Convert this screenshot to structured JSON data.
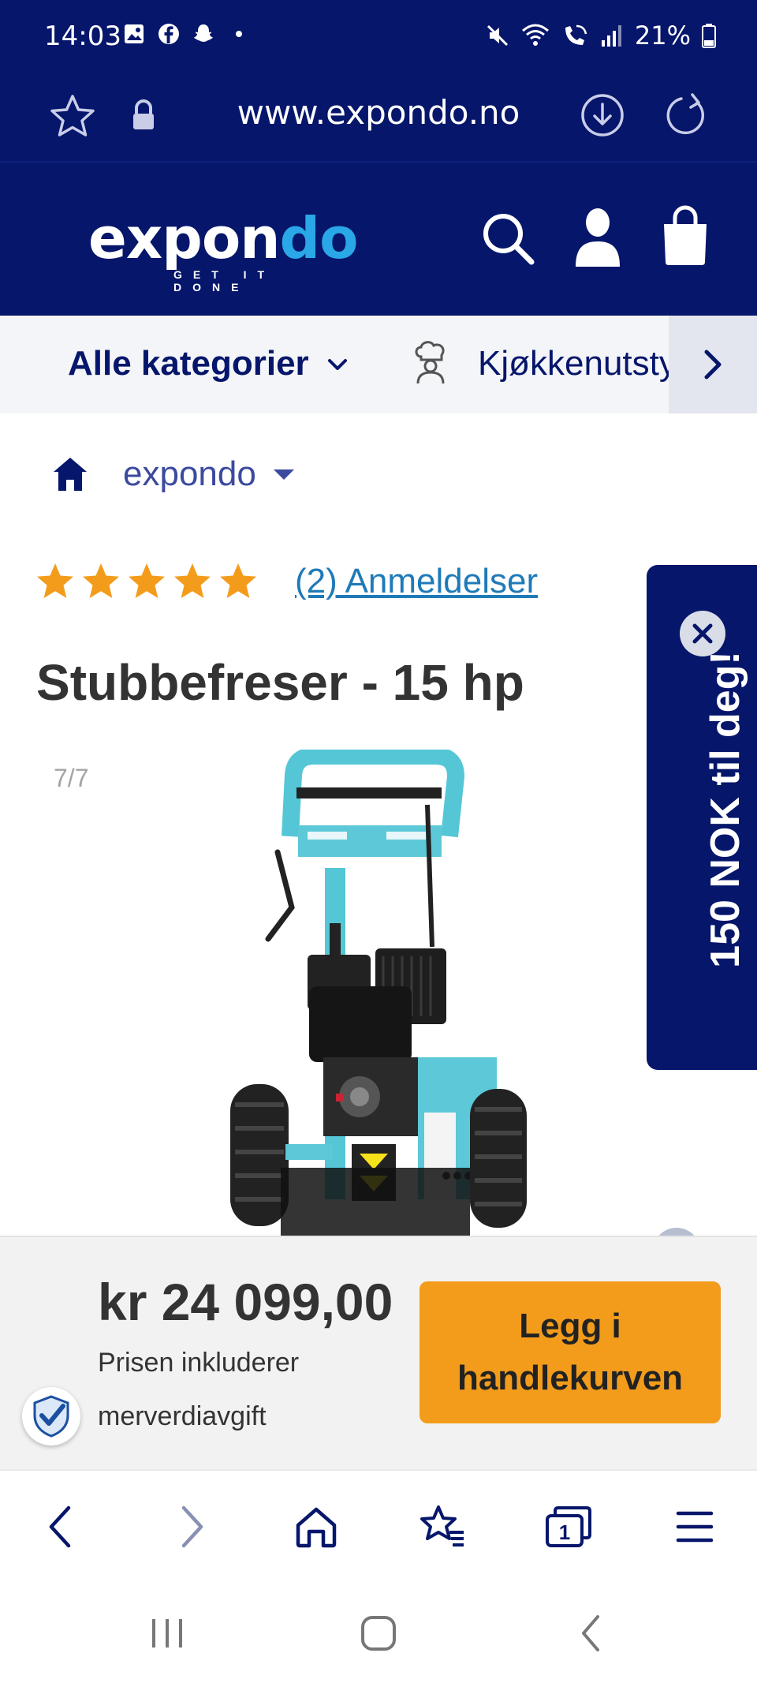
{
  "status_bar": {
    "time": "14:03",
    "battery": "21%",
    "left_icons": [
      "gallery-icon",
      "facebook-icon",
      "snapchat-icon"
    ],
    "right_icons": [
      "mute-icon",
      "wifi-icon",
      "wifi-calling-icon",
      "signal-icon",
      "battery-icon"
    ]
  },
  "url_bar": {
    "url": "www.expondo.no",
    "icons": [
      "star-icon",
      "lock-icon",
      "download-icon",
      "reload-icon"
    ]
  },
  "header": {
    "logo_main": "expon",
    "logo_accent": "do",
    "logo_tagline": "GET IT DONE",
    "icons": [
      "search-icon",
      "account-icon",
      "cart-icon"
    ],
    "brand_color": "#06166b",
    "accent_color": "#29a7e6"
  },
  "category_nav": {
    "all_label": "Alle kategorier",
    "item_label": "Kjøkkenutsty"
  },
  "breadcrumb": {
    "label": "expondo"
  },
  "product": {
    "rating_stars": 5,
    "rating_max": 5,
    "reviews_link": "(2) Anmeldelser",
    "title": "Stubbefreser - 15 hp",
    "gallery_counter": "7/7"
  },
  "promo": {
    "text": "150 NOK til deg!"
  },
  "purchase": {
    "price": "kr 24 099,00",
    "note_line1": "Prisen inkluderer",
    "note_line2": "merverdiavgift",
    "button_line1": "Legg i",
    "button_line2": "handlekurven",
    "button_color": "#f39c1c"
  },
  "browser_nav": {
    "tabs_count": "1",
    "icons": [
      "back-icon",
      "forward-icon",
      "home-icon",
      "bookmarks-icon",
      "tabs-icon",
      "menu-icon"
    ]
  },
  "android_nav": {
    "icons": [
      "recents-icon",
      "home-button-icon",
      "back-button-icon"
    ]
  }
}
